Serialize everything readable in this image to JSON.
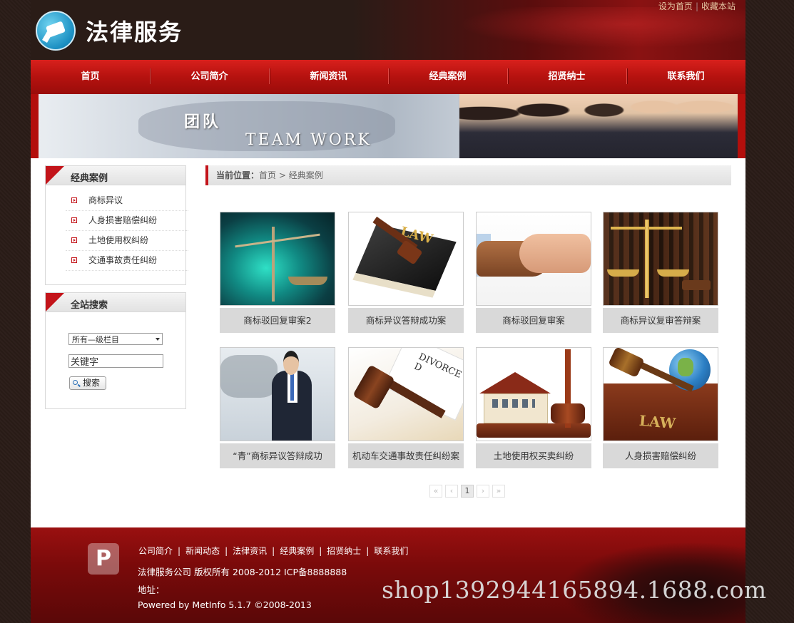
{
  "header": {
    "logo_text": "法律服务",
    "toplinks": [
      "设为首页",
      "收藏本站"
    ]
  },
  "nav": {
    "items": [
      "首页",
      "公司简介",
      "新闻资讯",
      "经典案例",
      "招贤纳士",
      "联系我们"
    ]
  },
  "banner": {
    "title_cn": "团队",
    "title_en": "TEAM WORK"
  },
  "sidebar": {
    "cases": {
      "title": "经典案例",
      "items": [
        "商标异议",
        "人身损害赔偿纠纷",
        "土地使用权纠纷",
        "交通事故责任纠纷"
      ]
    },
    "search": {
      "title": "全站搜索",
      "select_value": "所有—级栏目",
      "input_value": "关键字",
      "button_label": "搜索"
    }
  },
  "breadcrumb": {
    "label": "当前位置：",
    "home": "首页",
    "current": " > 经典案例"
  },
  "cases": [
    {
      "caption": "商标驳回复审案2"
    },
    {
      "caption": "商标异议答辩成功案"
    },
    {
      "caption": "商标驳回复审案"
    },
    {
      "caption": "商标异议复审答辩案"
    },
    {
      "caption": "“青”商标异议答辩成功"
    },
    {
      "caption": "机动车交通事故责任纠纷案"
    },
    {
      "caption": "土地使用权买卖纠纷"
    },
    {
      "caption": "人身损害赔偿纠纷"
    }
  ],
  "case_image_text": {
    "law_book": "LAW",
    "divorce_doc": "DIVORCE D",
    "law_book_2": "LAW"
  },
  "pagination": {
    "first": "«",
    "prev": "‹",
    "current": "1",
    "next": "›",
    "last": "»"
  },
  "footer": {
    "logo": "P",
    "links": [
      "公司简介",
      "新闻动态",
      "法律资讯",
      "经典案例",
      "招贤纳士",
      "联系我们"
    ],
    "copyright": "法律服务公司 版权所有 2008-2012  ICP备8888888",
    "address": "地址：",
    "powered": "Powered by MetInfo 5.1.7 ©2008-2013"
  },
  "watermark": "shop1392944165894.1688.com"
}
